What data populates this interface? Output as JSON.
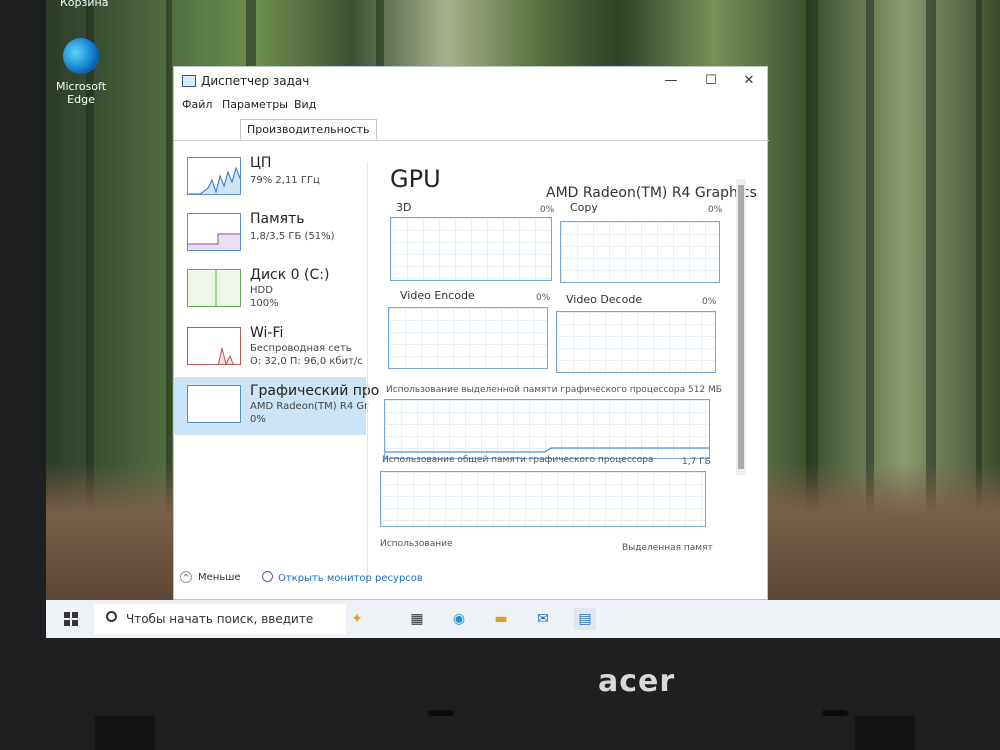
{
  "desktop": {
    "top_label": "Корзина",
    "edge_label": "Microsoft Edge"
  },
  "window": {
    "title": "Диспетчер задач",
    "controls": {
      "minimize": "—",
      "maximize": "☐",
      "close": "✕"
    },
    "menu": [
      "Файл",
      "Параметры",
      "Вид"
    ],
    "tab": "Производительность"
  },
  "sidebar": {
    "items": [
      {
        "name": "ЦП",
        "sub1": "79% 2,11 ГГц",
        "sub2": "",
        "active": false
      },
      {
        "name": "Память",
        "sub1": "1,8/3,5 ГБ (51%)",
        "sub2": "",
        "active": false
      },
      {
        "name": "Диск 0 (C:)",
        "sub1": "HDD",
        "sub2": "100%",
        "active": false
      },
      {
        "name": "Wi-Fi",
        "sub1": "Беспроводная сеть",
        "sub2": "О: 32,0 П: 96,0 кбит/с",
        "active": false
      },
      {
        "name": "Графический про",
        "sub1": "AMD Radeon(TM) R4 Gr",
        "sub2": "0%",
        "active": true
      }
    ]
  },
  "gpu": {
    "title": "GPU",
    "model": "AMD Radeon(TM) R4 Graphics",
    "engines": [
      {
        "label": "3D",
        "pct": "0%"
      },
      {
        "label": "Copy",
        "pct": "0%"
      },
      {
        "label": "Video Encode",
        "pct": "0%"
      },
      {
        "label": "Video Decode",
        "pct": "0%"
      }
    ],
    "dedicated_label": "Использование выделенной памяти графического процессора 512 МБ",
    "shared_label": "Использование общей памяти графического процессора",
    "shared_value": "1,7 ГБ",
    "footer_left": "Использование",
    "footer_right": "Выделенная памят"
  },
  "footer": {
    "less": "Меньше",
    "resource_monitor": "Открыть монитор ресурсов"
  },
  "taskbar": {
    "search_placeholder": "Чтобы начать поиск, введите"
  },
  "brand": "acer"
}
